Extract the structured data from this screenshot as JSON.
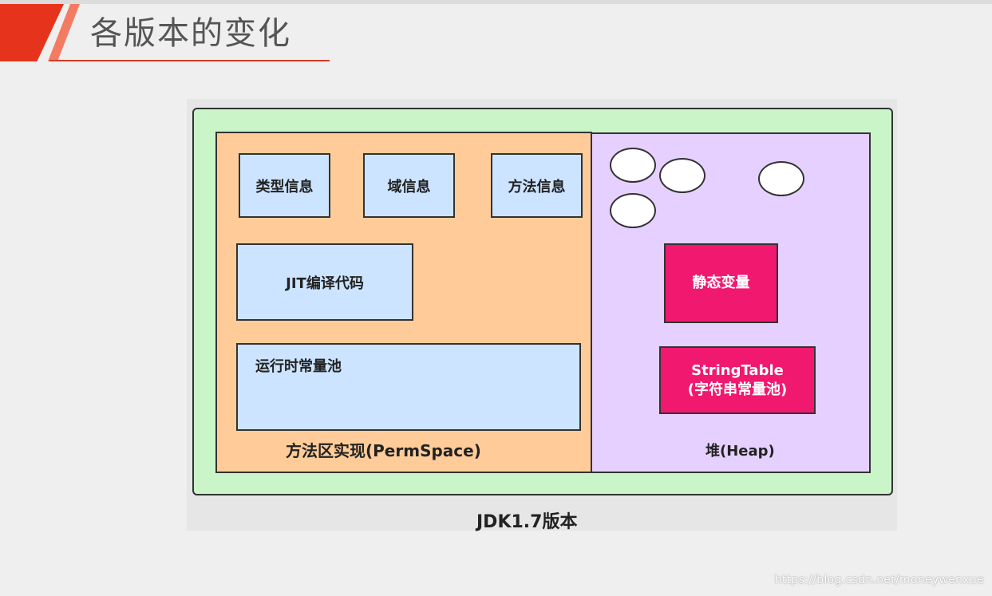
{
  "slide": {
    "title": "各版本的变化"
  },
  "diagram": {
    "method_area": {
      "label": "方法区实现(PermSpace)",
      "boxes": {
        "type_info": "类型信息",
        "field_info": "域信息",
        "method_info": "方法信息",
        "jit_code": "JIT编译代码",
        "runtime_constant_pool": "运行时常量池"
      }
    },
    "heap": {
      "label": "堆(Heap)",
      "static_vars": "静态变量",
      "string_table_line1": "StringTable",
      "string_table_line2": "(字符串常量池)"
    },
    "caption": "JDK1.7版本"
  },
  "watermark": "https://blog.csdn.net/moneywenxue",
  "colors": {
    "accent_red": "#e6341c",
    "jdk_frame": "#c9f5c8",
    "perm_area": "#ffcc99",
    "heap_area": "#e6d0ff",
    "info_box": "#cce4ff",
    "highlight_box": "#f0196f"
  }
}
